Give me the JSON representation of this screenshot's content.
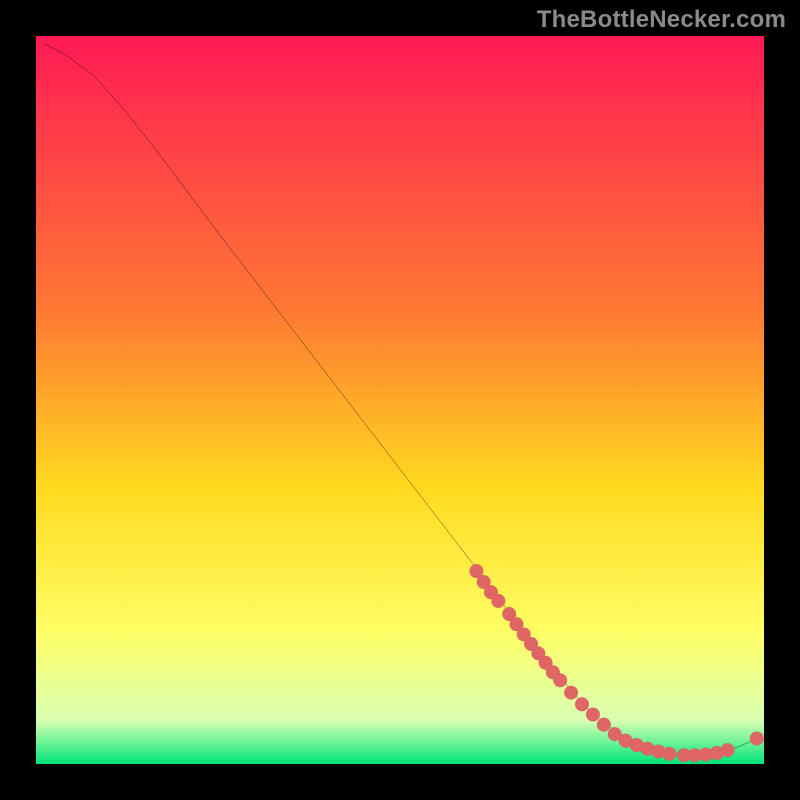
{
  "watermark": "TheBottleNecker.com",
  "colors": {
    "bg_black": "#000000",
    "curve": "#000000",
    "marker_fill": "#e06666",
    "marker_stroke": "#b94f4f",
    "grad_top": "#ff1a55",
    "grad_mid_top": "#ff7a33",
    "grad_mid": "#ffd91f",
    "grad_mid_bot": "#ffff66",
    "grad_near_bot": "#d9ffb3",
    "grad_bot": "#00e57a"
  },
  "chart_data": {
    "type": "line",
    "title": "",
    "xlabel": "",
    "ylabel": "",
    "xlim": [
      0,
      100
    ],
    "ylim": [
      0,
      100
    ],
    "grid": false,
    "legend": false,
    "curve": [
      {
        "x": 1,
        "y": 99
      },
      {
        "x": 4,
        "y": 97.5
      },
      {
        "x": 8,
        "y": 94.5
      },
      {
        "x": 12,
        "y": 90
      },
      {
        "x": 16,
        "y": 85
      },
      {
        "x": 25,
        "y": 73
      },
      {
        "x": 35,
        "y": 60
      },
      {
        "x": 45,
        "y": 47
      },
      {
        "x": 55,
        "y": 34
      },
      {
        "x": 60,
        "y": 27.5
      },
      {
        "x": 63,
        "y": 23.5
      },
      {
        "x": 66,
        "y": 19.5
      },
      {
        "x": 69,
        "y": 15.5
      },
      {
        "x": 72,
        "y": 12
      },
      {
        "x": 74,
        "y": 9.5
      },
      {
        "x": 76,
        "y": 7.5
      },
      {
        "x": 78,
        "y": 5.8
      },
      {
        "x": 80,
        "y": 4.2
      },
      {
        "x": 82,
        "y": 3.0
      },
      {
        "x": 84,
        "y": 2.1
      },
      {
        "x": 86,
        "y": 1.6
      },
      {
        "x": 88,
        "y": 1.3
      },
      {
        "x": 90,
        "y": 1.2
      },
      {
        "x": 92,
        "y": 1.3
      },
      {
        "x": 94,
        "y": 1.6
      },
      {
        "x": 96,
        "y": 2.2
      },
      {
        "x": 98,
        "y": 3.0
      },
      {
        "x": 99,
        "y": 3.5
      }
    ],
    "markers": [
      {
        "x": 60.5,
        "y": 26.5
      },
      {
        "x": 61.5,
        "y": 25.0
      },
      {
        "x": 62.5,
        "y": 23.6
      },
      {
        "x": 63.5,
        "y": 22.4
      },
      {
        "x": 65.0,
        "y": 20.6
      },
      {
        "x": 66.0,
        "y": 19.2
      },
      {
        "x": 67.0,
        "y": 17.8
      },
      {
        "x": 68.0,
        "y": 16.5
      },
      {
        "x": 69.0,
        "y": 15.2
      },
      {
        "x": 70.0,
        "y": 13.9
      },
      {
        "x": 71.0,
        "y": 12.6
      },
      {
        "x": 72.0,
        "y": 11.5
      },
      {
        "x": 73.5,
        "y": 9.8
      },
      {
        "x": 75.0,
        "y": 8.2
      },
      {
        "x": 76.5,
        "y": 6.8
      },
      {
        "x": 78.0,
        "y": 5.4
      },
      {
        "x": 79.5,
        "y": 4.1
      },
      {
        "x": 81.0,
        "y": 3.2
      },
      {
        "x": 82.5,
        "y": 2.6
      },
      {
        "x": 84.0,
        "y": 2.1
      },
      {
        "x": 85.5,
        "y": 1.7
      },
      {
        "x": 87.0,
        "y": 1.4
      },
      {
        "x": 89.0,
        "y": 1.2
      },
      {
        "x": 90.5,
        "y": 1.2
      },
      {
        "x": 92.0,
        "y": 1.3
      },
      {
        "x": 93.5,
        "y": 1.5
      },
      {
        "x": 95.0,
        "y": 1.9
      },
      {
        "x": 99.0,
        "y": 3.5
      }
    ]
  }
}
